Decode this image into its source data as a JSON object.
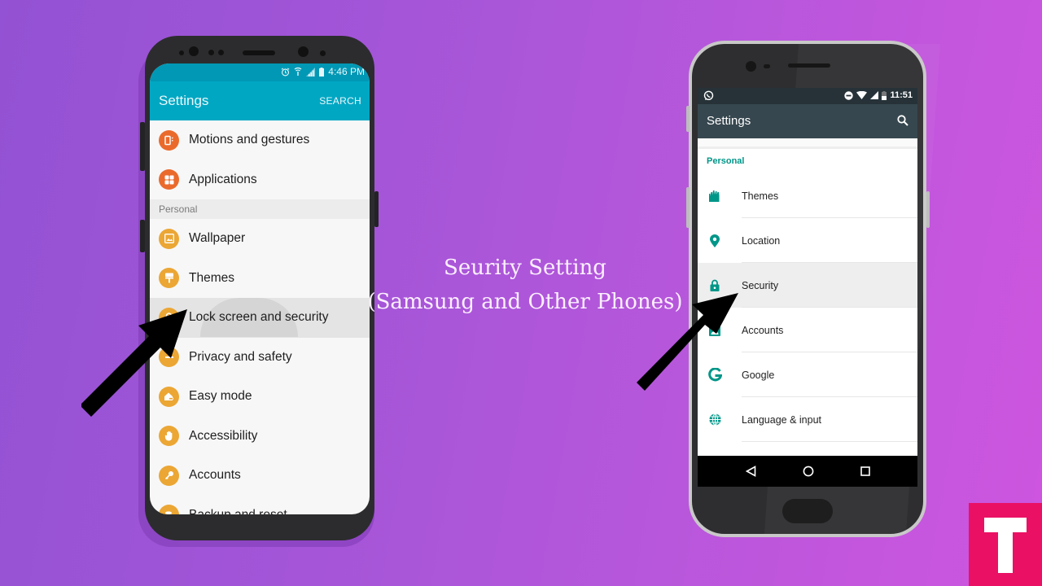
{
  "caption": {
    "line1": "Seurity Setting",
    "line2": "(Samsung and Other Phones)"
  },
  "samsung": {
    "status": {
      "time": "4:46 PM",
      "icons": [
        "alarm-icon",
        "wifi-icon",
        "signal-icon",
        "battery-icon"
      ]
    },
    "appbar": {
      "title": "Settings",
      "search_label": "SEARCH"
    },
    "items_top": [
      {
        "label": "Motions and gestures",
        "icon": "motion-icon",
        "color": "#ea6a2c"
      },
      {
        "label": "Applications",
        "icon": "apps-grid-icon",
        "color": "#ea6a2c"
      }
    ],
    "section": "Personal",
    "items": [
      {
        "label": "Wallpaper",
        "icon": "wallpaper-icon",
        "color": "#eba634"
      },
      {
        "label": "Themes",
        "icon": "paint-brush-icon",
        "color": "#eba634"
      },
      {
        "label": "Lock screen and security",
        "icon": "lock-icon",
        "color": "#eba634",
        "selected": true
      },
      {
        "label": "Privacy and safety",
        "icon": "privacy-icon",
        "color": "#eba634"
      },
      {
        "label": "Easy mode",
        "icon": "easy-mode-house-icon",
        "color": "#eba634"
      },
      {
        "label": "Accessibility",
        "icon": "hand-icon",
        "color": "#eba634"
      },
      {
        "label": "Accounts",
        "icon": "key-icon",
        "color": "#eba634"
      },
      {
        "label": "Backup and reset",
        "icon": "backup-icon",
        "color": "#eba634"
      }
    ]
  },
  "other": {
    "status": {
      "time": "11:51",
      "icons": [
        "whatsapp-icon",
        "do-not-disturb-icon",
        "wifi-icon",
        "signal-icon",
        "battery-icon"
      ]
    },
    "appbar": {
      "title": "Settings",
      "search_icon": "search-icon"
    },
    "section": "Personal",
    "accent": "#009688",
    "items": [
      {
        "label": "Themes",
        "icon": "themes-icon"
      },
      {
        "label": "Location",
        "icon": "location-pin-icon"
      },
      {
        "label": "Security",
        "icon": "lock-icon",
        "selected": true
      },
      {
        "label": "Accounts",
        "icon": "account-icon"
      },
      {
        "label": "Google",
        "icon": "google-g-icon"
      },
      {
        "label": "Language & input",
        "icon": "globe-icon"
      }
    ],
    "nav": [
      "back-icon",
      "home-icon",
      "recents-icon"
    ]
  },
  "logo": {
    "letter": "T",
    "color": "#ea1164"
  }
}
